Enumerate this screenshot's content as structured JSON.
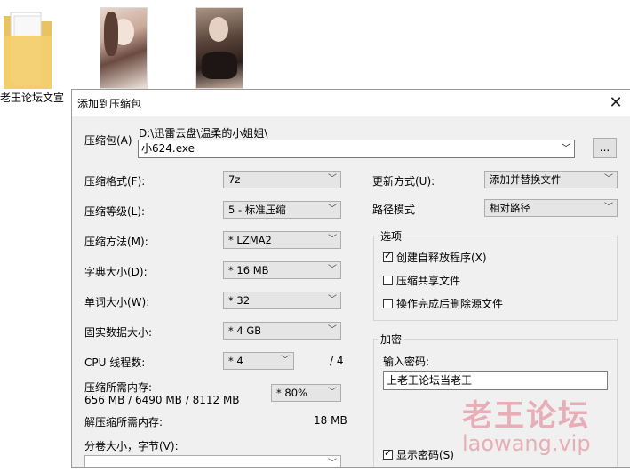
{
  "desktop": {
    "folder_label": "老王论坛文宣"
  },
  "dialog": {
    "title": "添加到压缩包",
    "close_glyph": "✕",
    "archive": {
      "label": "压缩包(A)",
      "path": "D:\\迅雷云盘\\温柔的小姐姐\\",
      "filename": "小624.exe",
      "browse_label": "..."
    },
    "left": {
      "format": {
        "label": "压缩格式(F):",
        "value": "7z"
      },
      "level": {
        "label": "压缩等级(L):",
        "value": "5 - 标准压缩"
      },
      "method": {
        "label": "压缩方法(M):",
        "value": "* LZMA2"
      },
      "dict": {
        "label": "字典大小(D):",
        "value": "* 16 MB"
      },
      "word": {
        "label": "单词大小(W):",
        "value": "* 32"
      },
      "solid": {
        "label": "固实数据大小:",
        "value": "* 4 GB"
      },
      "cpu": {
        "label": "CPU 线程数:",
        "value": "* 4",
        "max": "/ 4"
      },
      "mem_compress": {
        "label": "压缩所需内存:",
        "detail": "656 MB / 6490 MB / 8112 MB",
        "value": "* 80%"
      },
      "mem_decompress": {
        "label": "解压缩所需内存:",
        "value": "18 MB"
      },
      "volume": {
        "label": "分卷大小，字节(V):",
        "value": ""
      }
    },
    "right": {
      "update": {
        "label": "更新方式(U):",
        "value": "添加并替换文件"
      },
      "pathmode": {
        "label": "路径模式",
        "value": "相对路径"
      },
      "options": {
        "title": "选项",
        "sfx": {
          "label": "创建自释放程序(X)",
          "checked": true
        },
        "shared": {
          "label": "压缩共享文件",
          "checked": false
        },
        "delete": {
          "label": "操作完成后删除源文件",
          "checked": false
        }
      },
      "encryption": {
        "title": "加密",
        "password_label": "输入密码:",
        "password": "上老王论坛当老王",
        "show_password": {
          "label": "显示密码(S)",
          "checked": true
        }
      }
    }
  },
  "watermark": {
    "cn": "老王论坛",
    "url": "laowang.vip"
  }
}
